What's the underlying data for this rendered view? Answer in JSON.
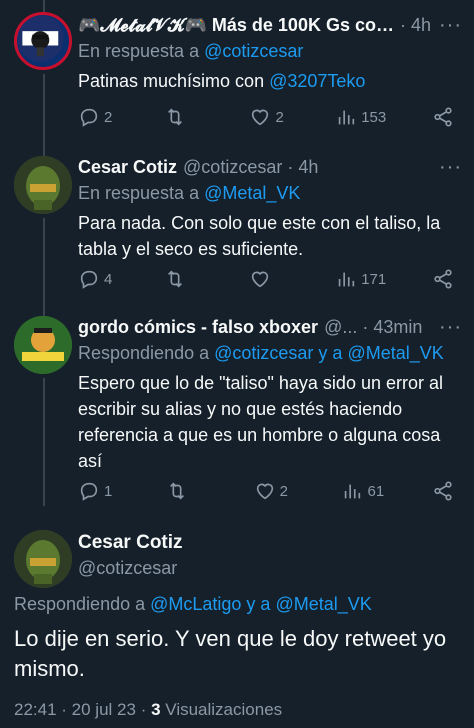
{
  "tweets": [
    {
      "name": "🎮𝓜𝓮𝓽𝓪𝓵𝓥𝓚🎮 Más de 100K Gs con...",
      "handle": "",
      "time": "4h",
      "reply_prefix": "En respuesta a",
      "reply_to": "@cotizcesar",
      "text_plain": "Patinas muchísimo con ",
      "text_link": "@3207Teko",
      "replies": "2",
      "retweets": "",
      "likes": "2",
      "views": "153"
    },
    {
      "name": "Cesar Cotiz",
      "handle": "@cotizcesar",
      "time": "4h",
      "reply_prefix": "En respuesta a",
      "reply_to": "@Metal_VK",
      "text_plain": "Para nada. Con solo que este con el taliso, la tabla y el seco es suficiente.",
      "replies": "4",
      "retweets": "",
      "likes": "",
      "views": "171"
    },
    {
      "name": "gordo cómics - falso xboxer",
      "handle": "@...",
      "time": "43min",
      "reply_prefix": "Respondiendo a",
      "reply_to": "@cotizcesar y a @Metal_VK",
      "text_plain": "Espero que lo de \"taliso\" haya sido un error al escribir su alias y no que estés haciendo referencia a que es un hombre o alguna cosa así",
      "replies": "1",
      "retweets": "",
      "likes": "2",
      "views": "61"
    }
  ],
  "main": {
    "name": "Cesar Cotiz",
    "handle": "@cotizcesar",
    "reply_prefix": "Respondiendo a",
    "reply_to": "@McLatigo y a @Metal_VK",
    "text": "Lo dije en serio. Y ven que le doy retweet yo mismo.",
    "time": "22:41",
    "date": "20 jul 23",
    "views": "3",
    "views_label": "Visualizaciones"
  },
  "more_icon": "···",
  "colors": {
    "background": "#15202b",
    "link": "#1d9bf0",
    "muted": "#8b98a5"
  }
}
